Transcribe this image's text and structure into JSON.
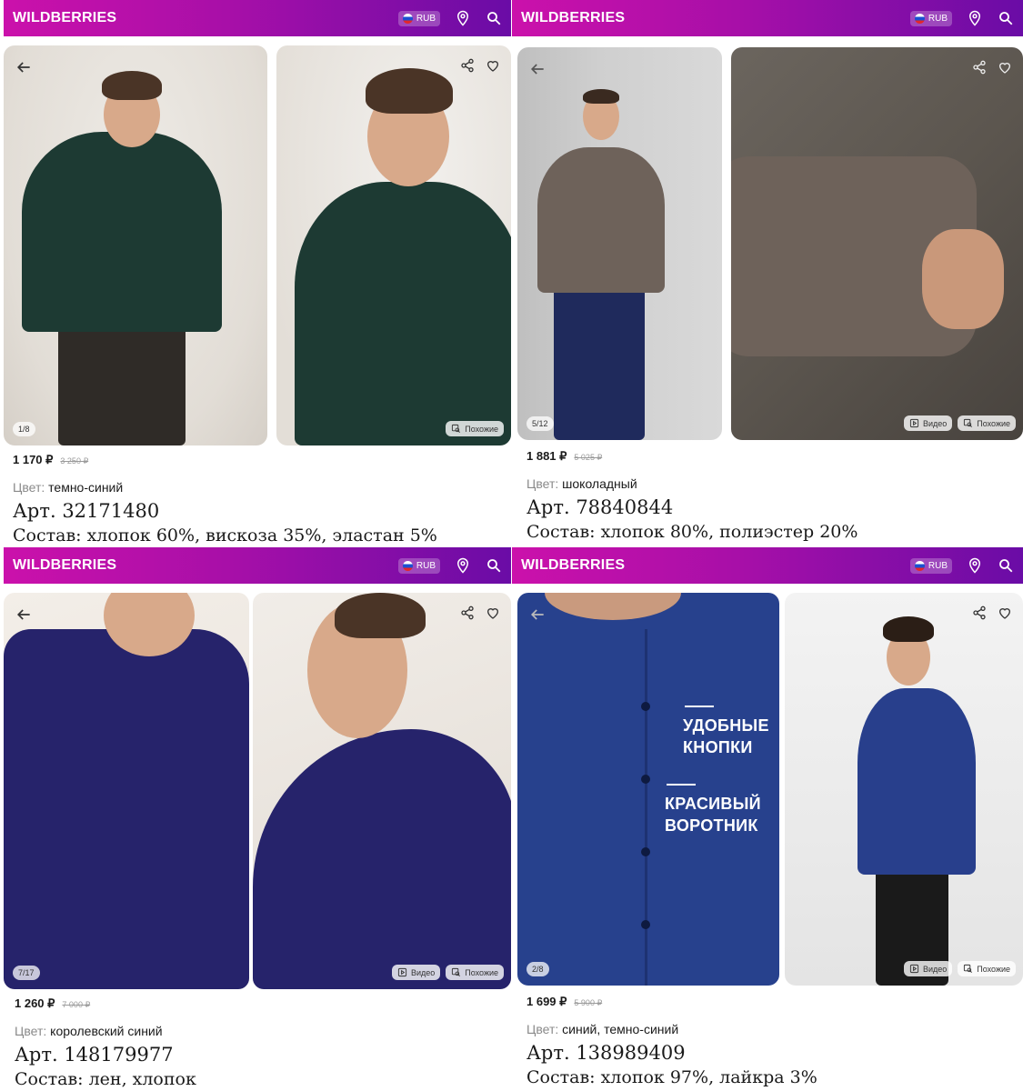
{
  "header": {
    "logo": "WILDBERRIES",
    "currency": "RUB"
  },
  "cards": [
    {
      "counter": "1/8",
      "similar_label": "Похожие",
      "video_label": "",
      "price": "1 170 ₽",
      "old_price": "3 250 ₽",
      "color_label": "Цвет:",
      "color_value": "темно-синий",
      "article": "Арт. 32171480",
      "composition": "Состав: хлопок 60%, вискоза 35%, эластан 5%",
      "shirt_color": "#1d3a33"
    },
    {
      "counter": "5/12",
      "similar_label": "Похожие",
      "video_label": "Видео",
      "price": "1 881 ₽",
      "old_price": "5 025 ₽",
      "color_label": "Цвет:",
      "color_value": "шоколадный",
      "article": "Арт. 78840844",
      "composition": "Состав: хлопок 80%, полиэстер 20%",
      "shirt_color": "#6e625a"
    },
    {
      "counter": "7/17",
      "similar_label": "Похожие",
      "video_label": "Видео",
      "price": "1 260 ₽",
      "old_price": "7 000 ₽",
      "color_label": "Цвет:",
      "color_value": "королевский синий",
      "article": "Арт. 148179977",
      "composition": "Состав: лен, хлопок",
      "shirt_color": "#26236b"
    },
    {
      "counter": "2/8",
      "similar_label": "Похожие",
      "video_label": "Видео",
      "price": "1 699 ₽",
      "old_price": "5 900 ₽",
      "color_label": "Цвет:",
      "color_value": "синий, темно-синий",
      "article": "Арт. 138989409",
      "composition": "Состав: хлопок 97%, лайкра 3%",
      "shirt_color": "#283f8c",
      "overlay_line1a": "УДОБНЫЕ",
      "overlay_line1b": "КНОПКИ",
      "overlay_line2a": "КРАСИВЫЙ",
      "overlay_line2b": "ВОРОТНИК"
    }
  ],
  "colors": {
    "brand_start": "#cb11ab",
    "brand_end": "#6a0ca6"
  },
  "icons": [
    "back-arrow-icon",
    "share-icon",
    "heart-icon",
    "location-pin-icon",
    "search-icon",
    "video-play-icon",
    "similar-search-icon",
    "russia-flag-icon"
  ]
}
